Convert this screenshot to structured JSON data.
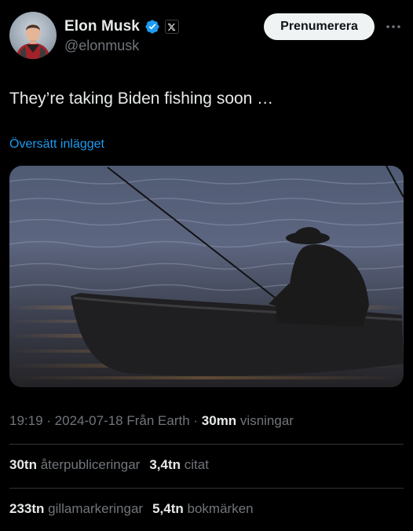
{
  "tweet": {
    "author": {
      "display_name": "Elon Musk",
      "handle": "@elonmusk",
      "verified_badge": "verified-checkmark-icon",
      "affiliate_badge": "x-logo-icon"
    },
    "subscribe_label": "Prenumerera",
    "text": "They’re taking Biden fishing soon …",
    "translate_label": "Översätt inlägget",
    "media": {
      "icon": "photo-fisherman-in-boat"
    },
    "meta": {
      "time": "19:19",
      "sep1": " · ",
      "date": "2024-07-18",
      "source": " Från Earth",
      "sep2": " · ",
      "views_count": "30mn",
      "views_label": " visningar"
    },
    "stats": {
      "reposts_count": "30tn",
      "reposts_label": " återpubliceringar",
      "quotes_count": "3,4tn",
      "quotes_label": " citat",
      "likes_count": "233tn",
      "likes_label": " gillamarkeringar",
      "bookmarks_count": "5,4tn",
      "bookmarks_label": " bokmärken"
    }
  },
  "colors": {
    "background": "#000000",
    "text_primary": "#e7e9ea",
    "text_secondary": "#71767b",
    "link": "#1d9bf0",
    "divider": "#2f3336",
    "button_bg": "#eff3f4"
  }
}
